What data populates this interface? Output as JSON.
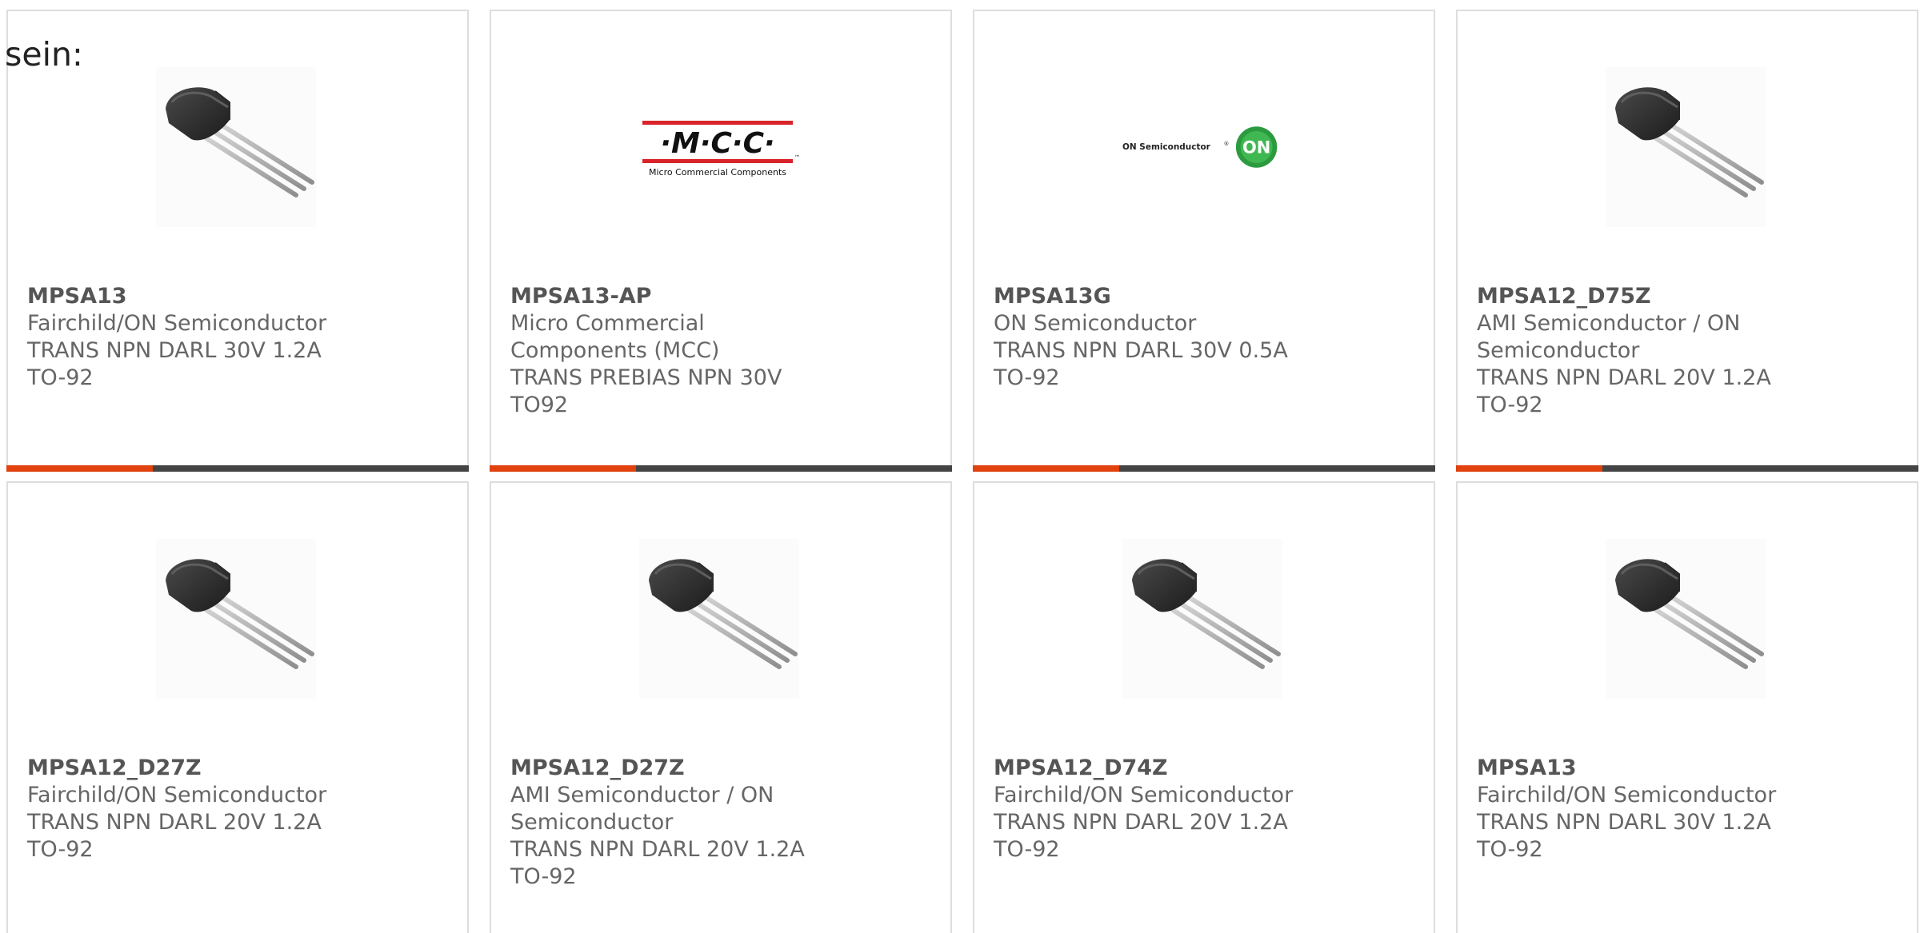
{
  "intro": {
    "text": "sein:"
  },
  "accent_color": "#e0410d",
  "bar_color": "#444444",
  "products": [
    {
      "part_number": "MPSA13",
      "manufacturer": "Fairchild/ON Semiconductor",
      "description": "TRANS NPN DARL 30V 1.2A TO-92",
      "image": "to92-transistor-image"
    },
    {
      "part_number": "MPSA13-AP",
      "manufacturer": "Micro Commercial Components (MCC)",
      "description": "TRANS PREBIAS NPN 30V TO92",
      "image": "mcc-logo",
      "logo": {
        "mark": "·M·C·C·",
        "name": "Micro Commercial Components",
        "trademark": "™"
      }
    },
    {
      "part_number": "MPSA13G",
      "manufacturer": "ON Semiconductor",
      "description": "TRANS NPN DARL 30V 0.5A TO-92",
      "image": "on-semiconductor-logo",
      "logo": {
        "name": "ON Semiconductor",
        "registered": "®",
        "badge": "ON"
      }
    },
    {
      "part_number": "MPSA12_D75Z",
      "manufacturer": "AMI Semiconductor / ON Semiconductor",
      "description": "TRANS NPN DARL 20V 1.2A TO-92",
      "image": "to92-transistor-image"
    },
    {
      "part_number": "MPSA12_D27Z",
      "manufacturer": "Fairchild/ON Semiconductor",
      "description": "TRANS NPN DARL 20V 1.2A TO-92",
      "image": "to92-transistor-image"
    },
    {
      "part_number": "MPSA12_D27Z",
      "manufacturer": "AMI Semiconductor / ON Semiconductor",
      "description": "TRANS NPN DARL 20V 1.2A TO-92",
      "image": "to92-transistor-image"
    },
    {
      "part_number": "MPSA12_D74Z",
      "manufacturer": "Fairchild/ON Semiconductor",
      "description": "TRANS NPN DARL 20V 1.2A TO-92",
      "image": "to92-transistor-image"
    },
    {
      "part_number": "MPSA13",
      "manufacturer": "Fairchild/ON Semiconductor",
      "description": "TRANS NPN DARL 30V 1.2A TO-92",
      "image": "to92-transistor-image"
    }
  ]
}
